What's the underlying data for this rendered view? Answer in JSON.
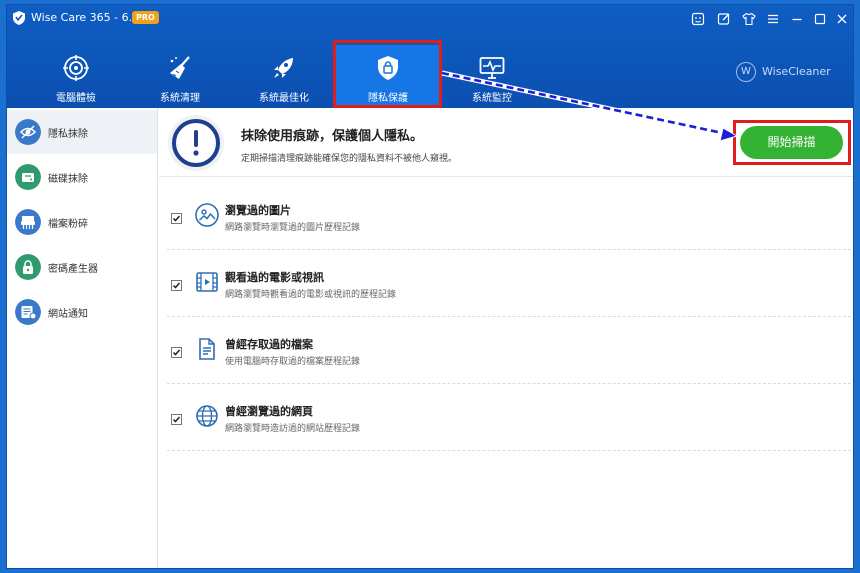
{
  "window": {
    "app_title": "Wise Care 365 - 6.3.2",
    "edition_badge": "PRO"
  },
  "nav": {
    "items": [
      {
        "label": "電腦體檢",
        "icon": "target-icon"
      },
      {
        "label": "系統清理",
        "icon": "broom-icon"
      },
      {
        "label": "系統最佳化",
        "icon": "rocket-icon"
      },
      {
        "label": "隱私保護",
        "icon": "shield-lock-icon"
      },
      {
        "label": "系統監控",
        "icon": "monitor-pulse-icon"
      }
    ],
    "active_index": 3
  },
  "brand": {
    "logo_letter": "W",
    "name": "WiseCleaner"
  },
  "sidebar": {
    "items": [
      {
        "label": "隱私抹除",
        "icon": "eye-off-icon",
        "color": "#3a78c9"
      },
      {
        "label": "磁碟抹除",
        "icon": "disk-erase-icon",
        "color": "#2e9a6d"
      },
      {
        "label": "檔案粉碎",
        "icon": "shredder-icon",
        "color": "#3a78c9"
      },
      {
        "label": "密碼產生器",
        "icon": "padlock-icon",
        "color": "#2e9a6d"
      },
      {
        "label": "網站通知",
        "icon": "web-notification-icon",
        "color": "#3a78c9"
      }
    ],
    "active_index": 0
  },
  "banner": {
    "title": "抹除使用痕跡，保護個人隱私。",
    "subtitle": "定期掃描清理痕跡能確保您的隱私資料不被他人窺視。",
    "scan_label": "開始掃描"
  },
  "items": [
    {
      "title": "瀏覽過的圖片",
      "subtitle": "網路瀏覽時瀏覽過的圖片歷程記錄",
      "checked": true,
      "icon": "image-icon"
    },
    {
      "title": "觀看過的電影或視訊",
      "subtitle": "網路瀏覽時觀看過的電影或視訊的歷程記錄",
      "checked": true,
      "icon": "film-icon"
    },
    {
      "title": "曾經存取過的檔案",
      "subtitle": "使用電腦時存取過的檔案歷程記錄",
      "checked": true,
      "icon": "document-icon"
    },
    {
      "title": "曾經瀏覽過的網頁",
      "subtitle": "網路瀏覽時造訪過的網站歷程記錄",
      "checked": true,
      "icon": "globe-icon"
    }
  ],
  "colors": {
    "header_bg": "#0b4fb0",
    "nav_active": "#1776e6",
    "accent_green": "#34b233",
    "highlight_red": "#e11c1c",
    "arrow_blue": "#1a1fd6"
  }
}
